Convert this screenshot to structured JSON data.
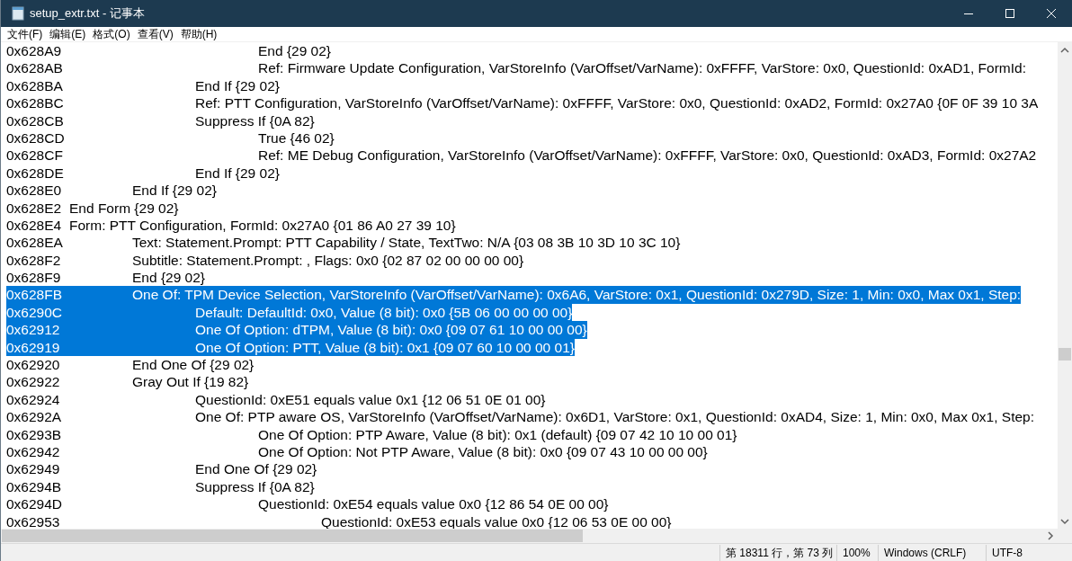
{
  "window": {
    "title": "setup_extr.txt - 记事本"
  },
  "menu": [
    "文件(F)",
    "编辑(E)",
    "格式(O)",
    "查看(V)",
    "帮助(H)"
  ],
  "lines": [
    {
      "children": [
        {
          "children": [
            {
              "children": [
                {
                  "address": "0x628A9",
                  "text": "End {29 02}",
                  "selected": false
                },
                {
                  "address": "0x628AB",
                  "text": "Ref: Firmware Update Configuration, VarStoreInfo (VarOffset/VarName): 0xFFFF, VarStore: 0x0, QuestionId: 0xAD1, FormId:",
                  "selected": false
                }
              ]
            },
            {
              "address": "0x628BA",
              "text": "End If {29 02}",
              "selected": false
            },
            {
              "address": "0x628BC",
              "text": "Ref: PTT Configuration, VarStoreInfo (VarOffset/VarName): 0xFFFF, VarStore: 0x0, QuestionId: 0xAD2, FormId: 0x27A0 {0F 0F 39 10 3A",
              "selected": false
            },
            {
              "address": "0x628CB",
              "text": "Suppress If {0A 82}",
              "selected": false,
              "children": [
                {
                  "address": "0x628CD",
                  "text": "True {46 02}",
                  "selected": false
                },
                {
                  "address": "0x628CF",
                  "text": "Ref: ME Debug Configuration, VarStoreInfo (VarOffset/VarName): 0xFFFF, VarStore: 0x0, QuestionId: 0xAD3, FormId: 0x27A2",
                  "selected": false
                }
              ]
            },
            {
              "address": "0x628DE",
              "text": "End If {29 02}",
              "selected": false
            }
          ]
        },
        {
          "address": "0x628E0",
          "text": "End If {29 02}",
          "selected": false
        }
      ]
    },
    {
      "address": "0x628E2",
      "text": "End Form {29 02}",
      "selected": false
    },
    {
      "address": "0x628E4",
      "text": "Form: PTT Configuration, FormId: 0x27A0 {01 86 A0 27 39 10}",
      "selected": false,
      "children": [
        {
          "address": "0x628EA",
          "text": "Text: Statement.Prompt: PTT Capability / State, TextTwo: N/A {03 08 3B 10 3D 10 3C 10}",
          "selected": false
        },
        {
          "address": "0x628F2",
          "text": "Subtitle: Statement.Prompt: , Flags: 0x0 {02 87 02 00 00 00 00}",
          "selected": false
        },
        {
          "address": "0x628F9",
          "text": "End {29 02}",
          "selected": false
        },
        {
          "address": "0x628FB",
          "text": "One Of: TPM Device Selection, VarStoreInfo (VarOffset/VarName): 0x6A6, VarStore: 0x1, QuestionId: 0x279D, Size: 1, Min: 0x0, Max 0x1, Step:",
          "selected": true,
          "children": [
            {
              "address": "0x6290C",
              "text": "Default: DefaultId: 0x0, Value (8 bit): 0x0 {5B 06 00 00 00 00}",
              "selected": true
            },
            {
              "address": "0x62912",
              "text": "One Of Option: dTPM, Value (8 bit): 0x0 {09 07 61 10 00 00 00}",
              "selected": true
            },
            {
              "address": "0x62919",
              "text": "One Of Option: PTT, Value (8 bit): 0x1 {09 07 60 10 00 00 01}",
              "selected": true
            }
          ]
        },
        {
          "address": "0x62920",
          "text": "End One Of {29 02}",
          "selected": false
        },
        {
          "address": "0x62922",
          "text": "Gray Out If {19 82}",
          "selected": false,
          "children": [
            {
              "address": "0x62924",
              "text": "QuestionId: 0xE51 equals value 0x1 {12 06 51 0E 01 00}",
              "selected": false
            },
            {
              "address": "0x6292A",
              "text": "One Of: PTP aware OS, VarStoreInfo (VarOffset/VarName): 0x6D1, VarStore: 0x1, QuestionId: 0xAD4, Size: 1, Min: 0x0, Max 0x1, Step:",
              "selected": false,
              "children": [
                {
                  "address": "0x6293B",
                  "text": "One Of Option: PTP Aware, Value (8 bit): 0x1 (default) {09 07 42 10 10 00 01}",
                  "selected": false
                },
                {
                  "address": "0x62942",
                  "text": "One Of Option: Not PTP Aware, Value (8 bit): 0x0 {09 07 43 10 00 00 00}",
                  "selected": false
                }
              ]
            },
            {
              "address": "0x62949",
              "text": "End One Of {29 02}",
              "selected": false
            },
            {
              "address": "0x6294B",
              "text": "Suppress If {0A 82}",
              "selected": false,
              "children": [
                {
                  "address": "0x6294D",
                  "text": "QuestionId: 0xE54 equals value 0x0 {12 86 54 0E 00 00}",
                  "selected": false,
                  "children": [
                    {
                      "address": "0x62953",
                      "text": "QuestionId: 0xE53 equals value 0x0 {12 06 53 0E 00 00}",
                      "selected": false
                    }
                  ]
                }
              ]
            }
          ]
        }
      ]
    }
  ],
  "status_bar": {
    "position": "第 18311 行，第 73 列",
    "zoom": "100%",
    "line_ending": "Windows (CRLF)",
    "encoding": "UTF-8"
  }
}
